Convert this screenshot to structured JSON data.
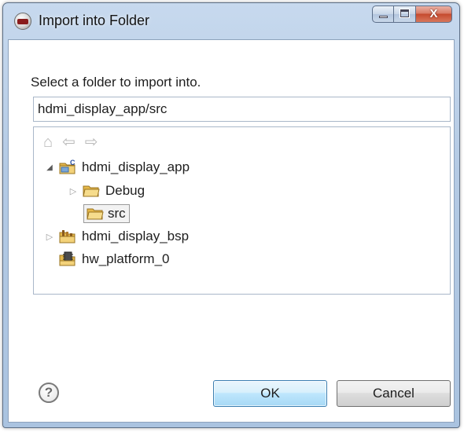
{
  "window": {
    "title": "Import into Folder",
    "icon": "sdk-icon",
    "controls": {
      "minimize": "minimize-icon",
      "maximize": "maximize-icon",
      "close_glyph": "X"
    }
  },
  "prompt": "Select a folder to import into.",
  "path_input": {
    "value": "hdmi_display_app/src"
  },
  "tree": {
    "nav": {
      "home": "⌂",
      "back": "⇦",
      "forward": "⇨"
    },
    "items": [
      {
        "label": "hdmi_display_app",
        "icon": "c-project-icon",
        "state": "expanded"
      },
      {
        "label": "Debug",
        "icon": "folder-icon",
        "state": "collapsed"
      },
      {
        "label": "src",
        "icon": "folder-open-icon",
        "state": "selected"
      },
      {
        "label": "hdmi_display_bsp",
        "icon": "bsp-icon",
        "state": "collapsed"
      },
      {
        "label": "hw_platform_0",
        "icon": "hw-platform-icon",
        "state": "leaf"
      }
    ]
  },
  "help": {
    "glyph": "?"
  },
  "buttons": {
    "ok": "OK",
    "cancel": "Cancel"
  },
  "colors": {
    "title_bar": "#b4cae4",
    "close_button": "#c54a2e",
    "ok_border": "#3c7fb1",
    "folder": "#e6b94a"
  }
}
